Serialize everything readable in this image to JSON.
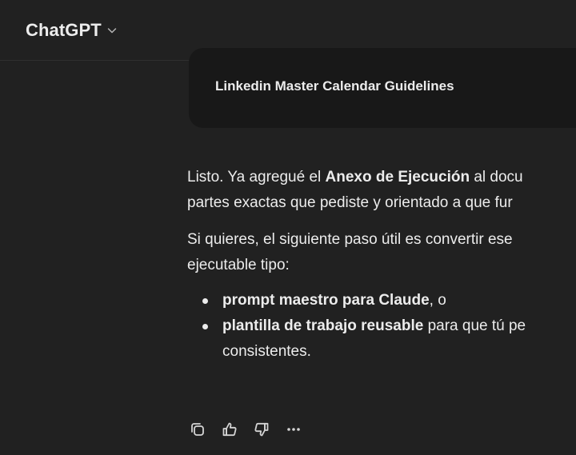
{
  "header": {
    "model_name": "ChatGPT",
    "chevron_icon": "chevron-down-icon"
  },
  "document_card": {
    "title": "Linkedin Master Calendar Guidelines"
  },
  "message": {
    "para1": {
      "before": "Listo. Ya agregué el ",
      "bold": "Anexo de Ejecución",
      "after": " al docu",
      "line2": "partes exactas que pediste y orientado a que fur"
    },
    "para2": {
      "line1": "Si quieres, el siguiente paso útil es convertir ese",
      "line2": "ejecutable tipo:"
    },
    "bullets": [
      {
        "bold": "prompt maestro para Claude",
        "rest": ", o",
        "continuation": ""
      },
      {
        "bold": "plantilla de trabajo reusable",
        "rest": " para que tú pe",
        "continuation": "consistentes."
      }
    ]
  },
  "actions": [
    {
      "name": "copy-icon"
    },
    {
      "name": "thumbs-up-icon"
    },
    {
      "name": "thumbs-down-icon"
    },
    {
      "name": "more-icon"
    }
  ],
  "colors": {
    "background": "#212121",
    "card": "#181818",
    "text": "#ececec",
    "icon": "#d4d4d4"
  }
}
